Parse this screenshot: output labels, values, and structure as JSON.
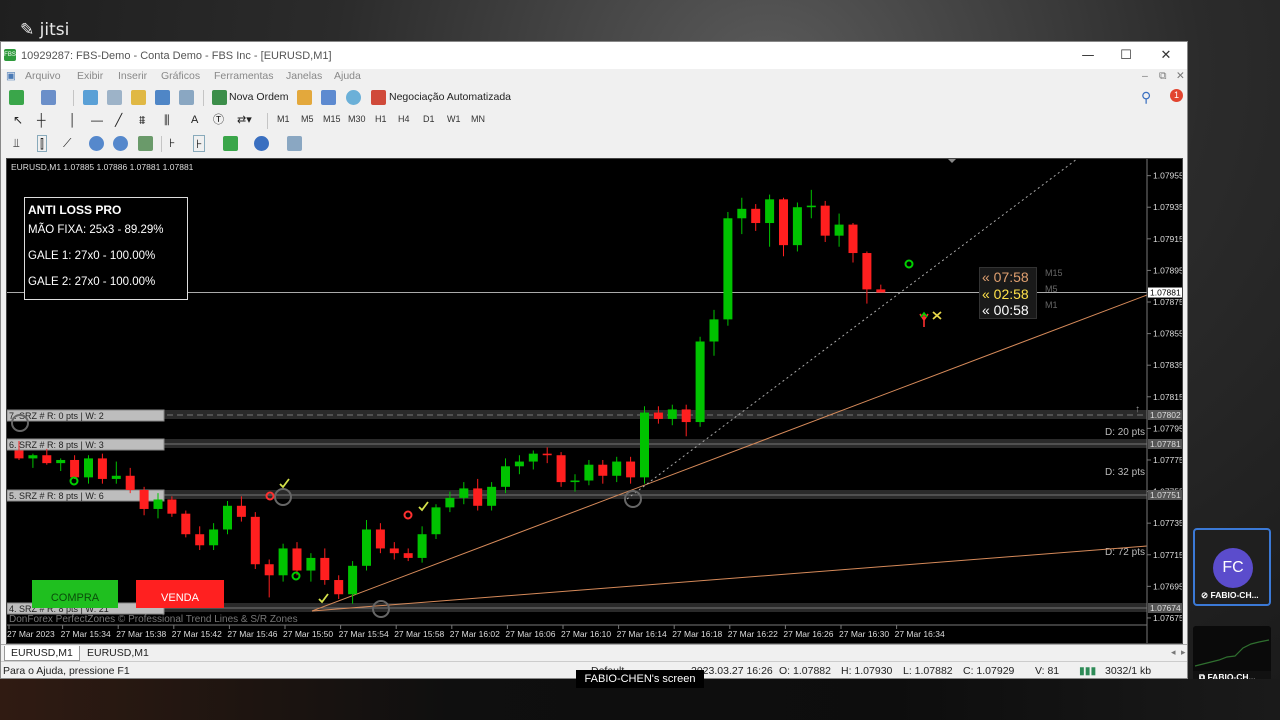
{
  "app": {
    "logo": "jitsi"
  },
  "window": {
    "title": "10929287: FBS-Demo - Conta Demo - FBS Inc - [EURUSD,M1]",
    "controls": {
      "minimize": "—",
      "maximize": "☐",
      "close": "✕"
    }
  },
  "menu": [
    "Arquivo",
    "Exibir",
    "Inserir",
    "Gráficos",
    "Ferramentas",
    "Janelas",
    "Ajuda"
  ],
  "toolbar": {
    "new_order": "Nova Ordem",
    "auto_trading": "Negociação Automatizada",
    "notification_count": "1"
  },
  "timeframes": [
    "M1",
    "M5",
    "M15",
    "M30",
    "H1",
    "H4",
    "D1",
    "W1",
    "MN"
  ],
  "chart": {
    "header": "EURUSD,M1  1.07885 1.07886 1.07881 1.07881",
    "footer_credit": "DonForex PerfectZones © Professional Trend Lines & S/R Zones",
    "colors": {
      "bull": "#00c300",
      "bear": "#ff1f1f",
      "background": "#000000",
      "trendline": "#d68a5a"
    },
    "price_axis": [
      "1.07955",
      "1.07935",
      "1.07915",
      "1.07895",
      "1.07875",
      "1.07855",
      "1.07835",
      "1.07815",
      "1.07795",
      "1.07775",
      "1.07755",
      "1.07735",
      "1.07715",
      "1.07695",
      "1.07675"
    ],
    "current_price": "1.07881",
    "zone_prices": [
      "1.07802",
      "1.07781",
      "1.07751",
      "1.07674"
    ],
    "time_axis": [
      "27 Mar 2023",
      "27 Mar 15:34",
      "27 Mar 15:38",
      "27 Mar 15:42",
      "27 Mar 15:46",
      "27 Mar 15:50",
      "27 Mar 15:54",
      "27 Mar 15:58",
      "27 Mar 16:02",
      "27 Mar 16:06",
      "27 Mar 16:10",
      "27 Mar 16:14",
      "27 Mar 16:18",
      "27 Mar 16:22",
      "27 Mar 16:26",
      "27 Mar 16:30",
      "27 Mar 16:34"
    ],
    "srz_labels": [
      "7. SRZ # R: 0 pts | W: 2",
      "6. SRZ # R: 8 pts | W: 3",
      "5. SRZ # R: 8 pts | W: 6",
      "4. SRZ # R: 8 pts | W: 21"
    ],
    "distances": [
      "D: 20 pts",
      "D: 32 pts",
      "D: 72 pts"
    ],
    "panel": {
      "title": "ANTI LOSS PRO",
      "lines": [
        "MÃO FIXA: 25x3 - 89.29%",
        "GALE 1: 27x0 - 100.00%",
        "GALE 2: 27x0 - 100.00%"
      ]
    },
    "timers": [
      {
        "value": "« 07:58",
        "tf": "M15",
        "color": "#e0a070"
      },
      {
        "value": "« 02:58",
        "tf": "M5",
        "color": "#ffe14a"
      },
      {
        "value": "« 00:58",
        "tf": "M1",
        "color": "#ffffff"
      }
    ],
    "buttons": {
      "buy": "COMPRA",
      "sell": "VENDA"
    },
    "candles": [
      [
        1.07781,
        1.07787,
        1.07775,
        1.07776
      ],
      [
        1.07776,
        1.07779,
        1.0777,
        1.07778
      ],
      [
        1.07778,
        1.07782,
        1.07772,
        1.07773
      ],
      [
        1.07773,
        1.07776,
        1.07768,
        1.07775
      ],
      [
        1.07775,
        1.07778,
        1.07763,
        1.07764
      ],
      [
        1.07764,
        1.07778,
        1.0776,
        1.07776
      ],
      [
        1.07776,
        1.07779,
        1.0776,
        1.07763
      ],
      [
        1.07763,
        1.07774,
        1.0776,
        1.07765
      ],
      [
        1.07765,
        1.0777,
        1.07754,
        1.07756
      ],
      [
        1.07756,
        1.07758,
        1.0774,
        1.07744
      ],
      [
        1.07744,
        1.07754,
        1.07738,
        1.0775
      ],
      [
        1.0775,
        1.07752,
        1.07739,
        1.07741
      ],
      [
        1.07741,
        1.07743,
        1.07726,
        1.07728
      ],
      [
        1.07728,
        1.07733,
        1.07718,
        1.07721
      ],
      [
        1.07721,
        1.07735,
        1.07718,
        1.07731
      ],
      [
        1.07731,
        1.07749,
        1.07728,
        1.07746
      ],
      [
        1.07746,
        1.07752,
        1.07736,
        1.07739
      ],
      [
        1.07739,
        1.07742,
        1.07706,
        1.07709
      ],
      [
        1.07709,
        1.07712,
        1.07688,
        1.07702
      ],
      [
        1.07702,
        1.07722,
        1.07698,
        1.07719
      ],
      [
        1.07719,
        1.07723,
        1.07702,
        1.07705
      ],
      [
        1.07705,
        1.07716,
        1.07698,
        1.07713
      ],
      [
        1.07713,
        1.07719,
        1.07696,
        1.07699
      ],
      [
        1.07699,
        1.07702,
        1.07687,
        1.0769
      ],
      [
        1.0769,
        1.07711,
        1.07684,
        1.07708
      ],
      [
        1.07708,
        1.07737,
        1.07705,
        1.07731
      ],
      [
        1.07731,
        1.07735,
        1.07716,
        1.07719
      ],
      [
        1.07719,
        1.07723,
        1.07712,
        1.07716
      ],
      [
        1.07716,
        1.07719,
        1.07711,
        1.07713
      ],
      [
        1.07713,
        1.07733,
        1.0771,
        1.07728
      ],
      [
        1.07728,
        1.07747,
        1.07725,
        1.07745
      ],
      [
        1.07745,
        1.07755,
        1.07742,
        1.07751
      ],
      [
        1.07751,
        1.07761,
        1.07747,
        1.07757
      ],
      [
        1.07757,
        1.07763,
        1.07743,
        1.07746
      ],
      [
        1.07746,
        1.07761,
        1.07743,
        1.07758
      ],
      [
        1.07758,
        1.07776,
        1.07754,
        1.07771
      ],
      [
        1.07771,
        1.07778,
        1.07766,
        1.07774
      ],
      [
        1.07774,
        1.07781,
        1.07769,
        1.07779
      ],
      [
        1.07779,
        1.07783,
        1.07773,
        1.07778
      ],
      [
        1.07778,
        1.0778,
        1.07758,
        1.07761
      ],
      [
        1.07761,
        1.07766,
        1.07755,
        1.07762
      ],
      [
        1.07762,
        1.07775,
        1.07759,
        1.07772
      ],
      [
        1.07772,
        1.07775,
        1.0776,
        1.07765
      ],
      [
        1.07765,
        1.07777,
        1.07761,
        1.07774
      ],
      [
        1.07774,
        1.07777,
        1.0776,
        1.07764
      ],
      [
        1.07764,
        1.07809,
        1.0776,
        1.07805
      ],
      [
        1.07805,
        1.07809,
        1.07798,
        1.07801
      ],
      [
        1.07801,
        1.0781,
        1.07797,
        1.07807
      ],
      [
        1.07807,
        1.0781,
        1.0779,
        1.07799
      ],
      [
        1.07799,
        1.07853,
        1.07796,
        1.0785
      ],
      [
        1.0785,
        1.0787,
        1.07841,
        1.07864
      ],
      [
        1.07864,
        1.07932,
        1.0786,
        1.07928
      ],
      [
        1.07928,
        1.07941,
        1.07918,
        1.07934
      ],
      [
        1.07934,
        1.07937,
        1.0792,
        1.07925
      ],
      [
        1.07925,
        1.07943,
        1.0791,
        1.0794
      ],
      [
        1.0794,
        1.07941,
        1.07904,
        1.07911
      ],
      [
        1.07911,
        1.07938,
        1.07907,
        1.07935
      ],
      [
        1.07935,
        1.07946,
        1.07928,
        1.07936
      ],
      [
        1.07936,
        1.07939,
        1.07913,
        1.07917
      ],
      [
        1.07917,
        1.07931,
        1.0791,
        1.07924
      ],
      [
        1.07924,
        1.07925,
        1.079,
        1.07906
      ],
      [
        1.07906,
        1.07907,
        1.07874,
        1.07883
      ],
      [
        1.07883,
        1.07886,
        1.07881,
        1.07881
      ]
    ]
  },
  "tabs": [
    "EURUSD,M1",
    "EURUSD,M1"
  ],
  "status": {
    "help": "Para o Ajuda, pressione F1",
    "profile": "Default",
    "datetime": "2023.03.27 16:26",
    "open": "O: 1.07882",
    "high": "H: 1.07930",
    "low": "L: 1.07882",
    "close": "C: 1.07929",
    "volume": "V: 81",
    "traffic": "3032/1 kb"
  },
  "participant": {
    "initials": "FC",
    "name": "FABIO-CH...",
    "name2": "FABIO-CH..."
  },
  "screen_share_label": "FABIO-CHEN's screen"
}
